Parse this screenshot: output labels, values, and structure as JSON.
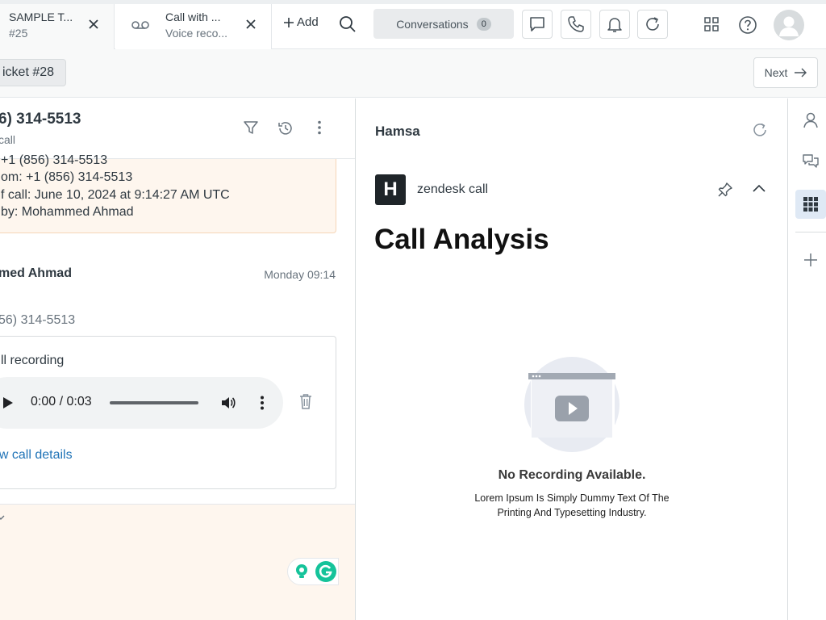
{
  "tabs": [
    {
      "title": "SAMPLE T...",
      "subtitle": "#25"
    },
    {
      "title": "Call with ...",
      "subtitle": "Voice reco..."
    }
  ],
  "toolbar": {
    "add_label": "Add",
    "conversations_label": "Conversations",
    "conversations_count": "0"
  },
  "subbar": {
    "ticket_label": "icket #28",
    "next_label": "Next"
  },
  "conversation": {
    "phone_title": "6) 314-5513",
    "phone_subtitle": "call",
    "note_lines": [
      "+1 (856) 314-5513",
      "om: +1 (856) 314-5513",
      "f call: June 10, 2024 at 9:14:27 AM UTC",
      "by: Mohammed Ahmad"
    ],
    "author": "med Ahmad",
    "time": "Monday 09:14",
    "phone": "56) 314-5513",
    "recording_title": "ll recording",
    "player_time": "0:00 / 0:03",
    "details_link": "ow call details"
  },
  "app": {
    "title": "Hamsa",
    "logo_letter": "H",
    "name": "zendesk call",
    "analysis_title": "Call Analysis",
    "empty_title": "No Recording Available.",
    "empty_desc": "Lorem Ipsum Is Simply Dummy Text Of The Printing And Typesetting Industry."
  },
  "colors": {
    "accent": "#1f73b7",
    "note_bg": "#fef6ee",
    "rail_active": "#dfe9f5",
    "grammarly": "#15c39a"
  }
}
